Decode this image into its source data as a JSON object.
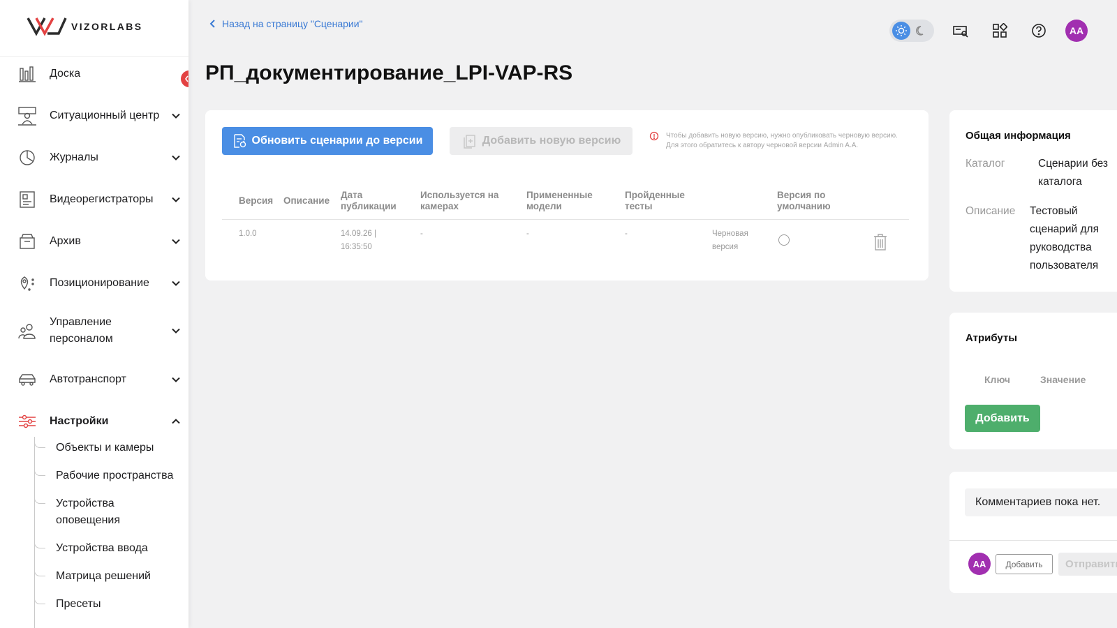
{
  "brand": {
    "name": "VIZORLABS",
    "accent": "#4a8ee4",
    "danger": "#e34242",
    "success": "#4eae6c",
    "avatar_color": "#a12fb0"
  },
  "sidebar": {
    "items": [
      {
        "label": "Доска",
        "icon": "chart-icon"
      },
      {
        "label": "Ситуационный центр",
        "icon": "operator-desk-icon"
      },
      {
        "label": "Журналы",
        "icon": "pie-chart-icon"
      },
      {
        "label": "Видеорегистраторы",
        "icon": "video-recorder-icon"
      },
      {
        "label": "Архив",
        "icon": "archive-box-icon"
      },
      {
        "label": "Позиционирование",
        "icon": "location-pin-icon"
      },
      {
        "label_line1": "Управление",
        "label_line2": "персоналом",
        "icon": "people-icon"
      },
      {
        "label": "Автотранспорт",
        "icon": "car-icon"
      },
      {
        "label": "Настройки",
        "icon": "sliders-icon"
      }
    ],
    "settings_sub": [
      {
        "label": "Объекты и камеры"
      },
      {
        "label": "Рабочие пространства"
      },
      {
        "label_line1": "Устройства",
        "label_line2": "оповещения"
      },
      {
        "label": "Устройства ввода"
      },
      {
        "label": "Матрица решений"
      },
      {
        "label": "Пресеты"
      }
    ]
  },
  "header": {
    "back_label": "Назад на страницу \"Сценарии\"",
    "title": "РП_документирование_LPI-VAP-RS",
    "user_initials": "AA"
  },
  "versions": {
    "update_button": "Обновить сценарии до версии",
    "add_button": "Добавить новую версию",
    "warning_line1": "Чтобы добавить новую версию, нужно опубликовать черновую версию.",
    "warning_line2": "Для этого обратитесь к автору черновой версии Admin A.A.",
    "columns": {
      "version": "Версия",
      "description": "Описание",
      "date_l1": "Дата",
      "date_l2": "публикации",
      "cams_l1": "Используется на",
      "cams_l2": "камерах",
      "models_l1": "Примененные",
      "models_l2": "модели",
      "tests_l1": "Пройденные",
      "tests_l2": "тесты",
      "default_l1": "Версия по",
      "default_l2": "умолчанию"
    },
    "rows": [
      {
        "version": "1.0.0",
        "date_l1": "14.09.26 |",
        "date_l2": "16:35:50",
        "cams": "-",
        "models": "-",
        "tests": "-",
        "status_l1": "Черновая",
        "status_l2": "версия"
      }
    ]
  },
  "info": {
    "title": "Общая информация",
    "catalog_key": "Каталог",
    "catalog_val_l1": "Сценарии без",
    "catalog_val_l2": "каталога",
    "desc_key": "Описание",
    "desc_val_l1": "Тестовый",
    "desc_val_l2": "сценарий для",
    "desc_val_l3": "руководства",
    "desc_val_l4": "пользователя"
  },
  "attributes": {
    "title": "Атрибуты",
    "key_col": "Ключ",
    "value_col": "Значение",
    "add_button": "Добавить"
  },
  "comments": {
    "empty_text": "Комментариев пока нет.",
    "add_button": "Добавить",
    "send_button": "Отправить",
    "user_initials": "AA"
  }
}
